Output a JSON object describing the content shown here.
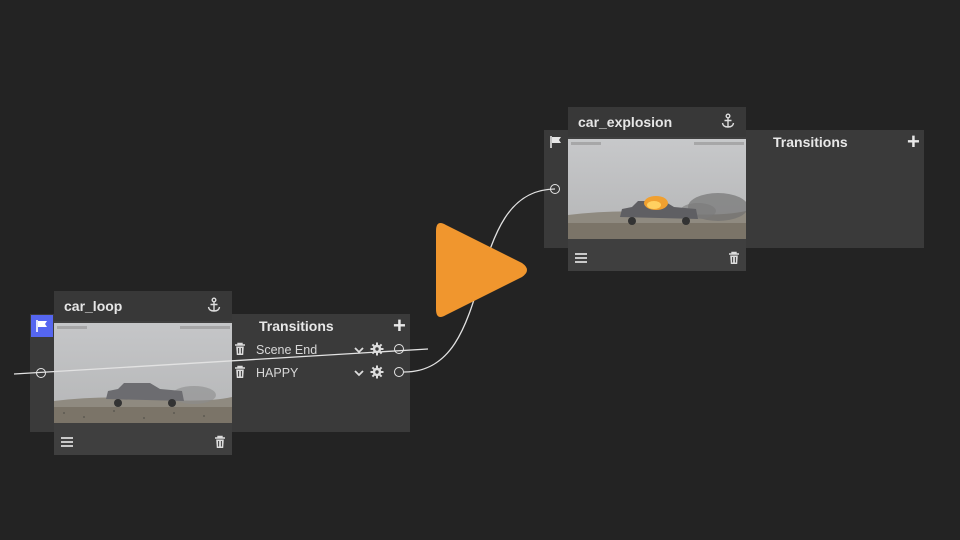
{
  "nodes": [
    {
      "title": "car_loop",
      "transitions_header": "Transitions",
      "transitions": [
        {
          "label": "Scene End"
        },
        {
          "label": "HAPPY"
        }
      ],
      "is_start": true
    },
    {
      "title": "car_explosion",
      "transitions_header": "Transitions",
      "transitions": [],
      "is_start": false
    }
  ],
  "colors": {
    "background": "#232323",
    "start_flag_bg": "#5566f0",
    "play_button": "#f0962e"
  },
  "icons": [
    "flag-icon",
    "anchor-icon",
    "plus-icon",
    "trash-icon",
    "chevron-down-icon",
    "gear-icon",
    "menu-icon",
    "play-icon"
  ]
}
